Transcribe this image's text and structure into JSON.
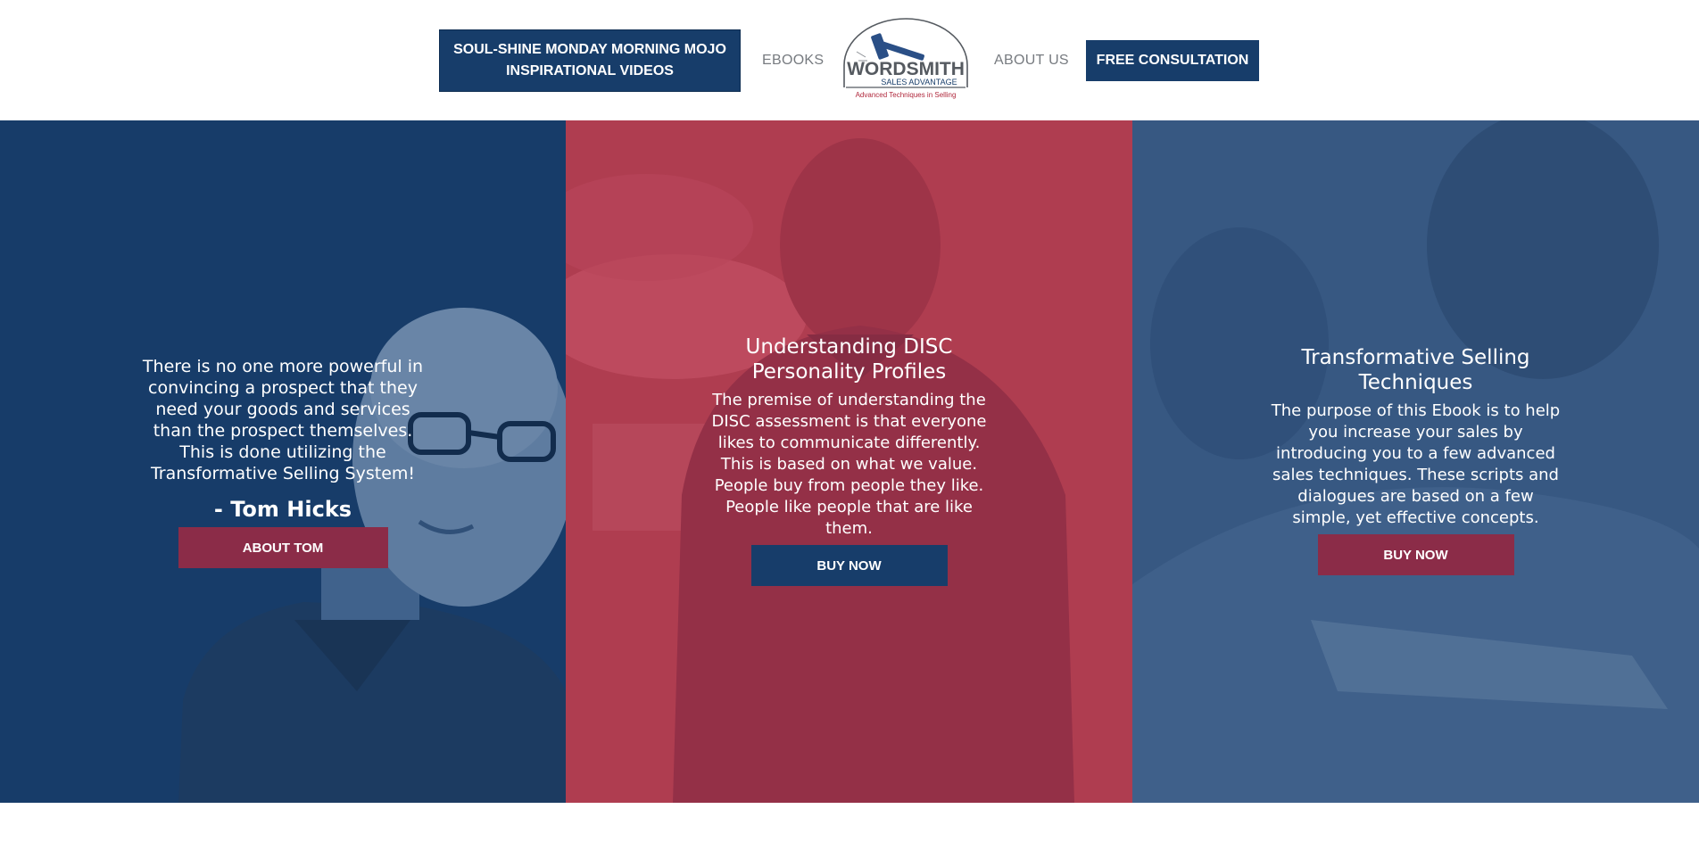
{
  "header": {
    "mojo_button": "SOUL-SHINE MONDAY MORNING MOJO INSPIRATIONAL VIDEOS",
    "ebooks_link": "EBOOKS",
    "about_link": "ABOUT US",
    "consultation_button": "FREE CONSULTATION",
    "logo": {
      "name": "WORDSMITH",
      "subtitle": "SALES ADVANTAGE",
      "tagline": "Advanced Techniques in Selling"
    }
  },
  "panels": [
    {
      "quote": "There is no one more powerful in convincing a prospect that they need your goods and services than the prospect themselves. This is done utilizing the Transformative Selling System!",
      "author": "- Tom Hicks",
      "button": "ABOUT TOM",
      "color": "#173d6a"
    },
    {
      "title": "Understanding DISC Personality Profiles",
      "text": "The premise of understanding the DISC assessment is that everyone likes to communicate differently. This is based on what we value. People buy from people they like. People like people that are like them.",
      "button": "BUY NOW",
      "color": "#a8384a"
    },
    {
      "title": "Transformative Selling Techniques",
      "text": "The purpose of this Ebook is to help you increase your sales by introducing you to a few advanced sales techniques. These scripts and dialogues are based on a few simple, yet effective concepts.",
      "button": "BUY NOW",
      "color": "#2f4f78"
    }
  ],
  "colors": {
    "navy": "#173d6a",
    "crimson": "#8b2c48",
    "gray_link": "#777b80"
  }
}
